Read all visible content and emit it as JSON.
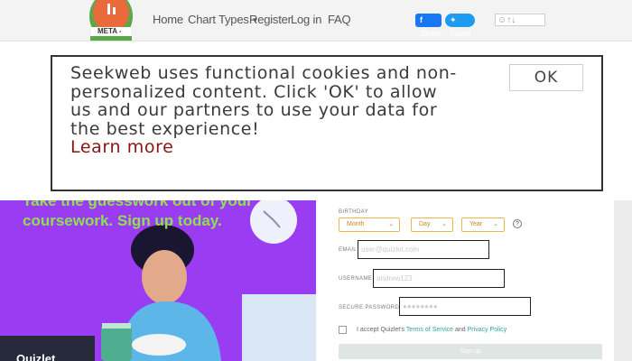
{
  "nav": {
    "logo_text": "META -",
    "links": [
      "Home",
      "Chart Types",
      "Register",
      "Log in",
      "FAQ"
    ],
    "share_label": "Share",
    "tweet_label": "Tweet"
  },
  "cookie": {
    "message": "Seekweb uses functional cookies and non-personalized content. Click 'OK' to allow us and our partners to use your data for the best experience!",
    "learn_more": "Learn more",
    "ok_label": "OK"
  },
  "promo": {
    "headline": "Take the guesswork out of your coursework. Sign up today.",
    "brand": "Quizlet"
  },
  "form": {
    "birthday_label": "BIRTHDAY",
    "month_label": "Month",
    "day_label": "Day",
    "year_label": "Year",
    "email_label": "EMAIL",
    "email_placeholder": "user@quizlet.com",
    "username_label": "USERNAME",
    "username_placeholder": "andrew123",
    "password_label": "SECURE PASSWORD",
    "password_placeholder": "●●●●●●●●",
    "terms_prefix": "I accept Quizlet's",
    "terms_link": "Terms of Service",
    "terms_and": "and",
    "privacy_link": "Privacy Policy",
    "signup_label": "Sign up"
  },
  "colors": {
    "promo_bg": "#9a3cf2",
    "promo_text": "#8ee04f",
    "accent_select": "#e8b84a",
    "link_teal": "#2ea3a3"
  }
}
